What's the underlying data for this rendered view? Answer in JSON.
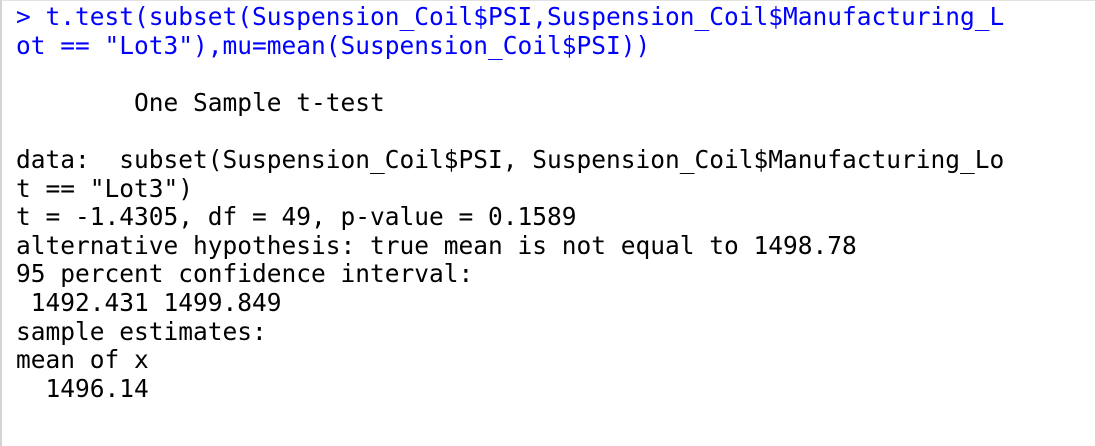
{
  "console": {
    "command": {
      "prompt": ">",
      "line1": " t.test(subset(Suspension_Coil$PSI,Suspension_Coil$Manufacturing_L",
      "line2": "ot == \"Lot3\"),mu=mean(Suspension_Coil$PSI))"
    },
    "output": {
      "title": "        One Sample t-test",
      "data_line1": "data:  subset(Suspension_Coil$PSI, Suspension_Coil$Manufacturing_Lo",
      "data_line2": "t == \"Lot3\")",
      "stats": "t = -1.4305, df = 49, p-value = 0.1589",
      "alternative": "alternative hypothesis: true mean is not equal to 1498.78",
      "ci_label": "95 percent confidence interval:",
      "ci_values": " 1492.431 1499.849",
      "estimates_label": "sample estimates:",
      "estimate_header": "mean of x",
      "estimate_value": "  1496.14"
    }
  }
}
